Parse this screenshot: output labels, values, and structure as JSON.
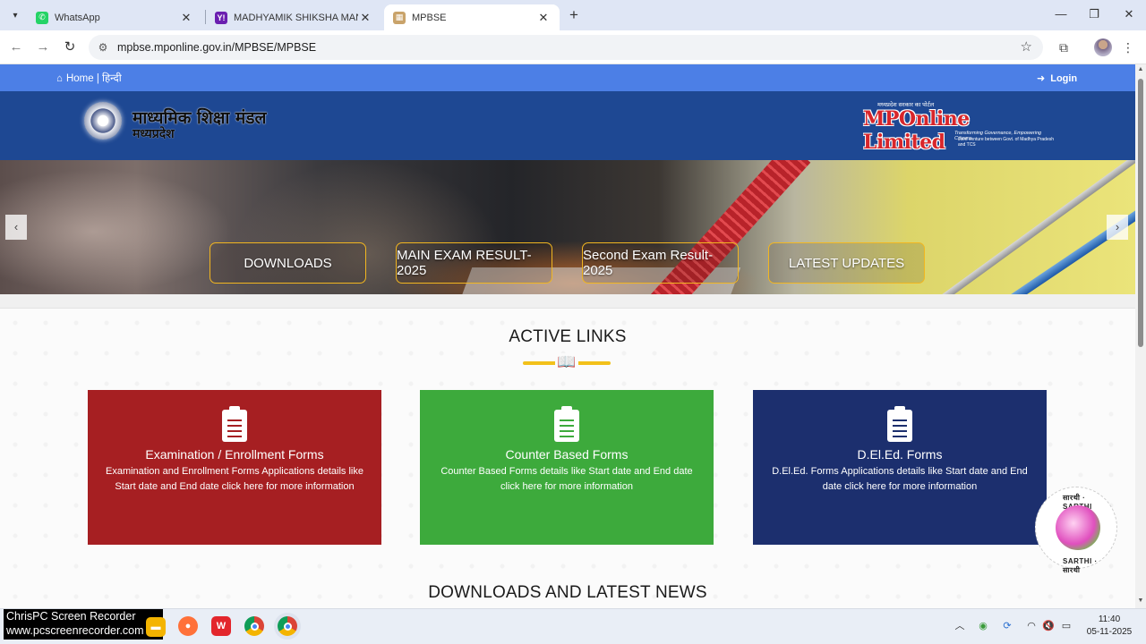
{
  "browser": {
    "tabs": [
      {
        "title": "WhatsApp",
        "active": false
      },
      {
        "title": "MADHYAMIK SHIKSHA MANDIR",
        "active": false
      },
      {
        "title": "MPBSE",
        "active": true
      }
    ],
    "url": "mpbse.mponline.gov.in/MPBSE/MPBSE"
  },
  "topbar": {
    "home_label": "Home | हिन्दी",
    "login_label": "Login"
  },
  "header": {
    "brand_line1": "माध्यमिक शिक्षा मंडल",
    "brand_line2": "मध्यप्रदेश",
    "partner_tagline": "मध्यप्रदेश सरकार का पोर्टल",
    "partner_logo": "MPOnline Limited",
    "partner_sub1": "Transforming Governance, Empowering Citizens",
    "partner_sub2": "Joint venture between Govt. of Madhya Pradesh and TCS"
  },
  "banner": {
    "buttons": [
      "DOWNLOADS",
      "MAIN EXAM RESULT-2025",
      "Second Exam Result-2025",
      "LATEST UPDATES"
    ]
  },
  "active_links": {
    "title": "ACTIVE LINKS",
    "cards": [
      {
        "title": "Examination / Enrollment Forms",
        "desc": "Examination and Enrollment Forms Applications details like Start date and End date click here for more information",
        "color": "#a61f22"
      },
      {
        "title": "Counter Based Forms",
        "desc": "Counter Based Forms details like Start date and End date click here for more information",
        "color": "#3daa3c"
      },
      {
        "title": "D.El.Ed. Forms",
        "desc": "D.El.Ed. Forms Applications details like Start date and End date click here for more information",
        "color": "#1c2f6e"
      }
    ]
  },
  "downloads_title": "DOWNLOADS AND LATEST NEWS",
  "sarthi": {
    "label_top": "सारथी · SARTHI",
    "label_bottom": "SARTHI · सारथी"
  },
  "recorder": {
    "line1": "ChrisPC Screen Recorder",
    "line2": "www.pcscreenrecorder.com"
  },
  "clock": {
    "time": "11:40",
    "date": "05-11-2025"
  },
  "colors": {
    "topbar": "#4c7fe6",
    "header": "#1e4893",
    "banner_border": "#f2b620",
    "divider": "#f2c11a"
  }
}
